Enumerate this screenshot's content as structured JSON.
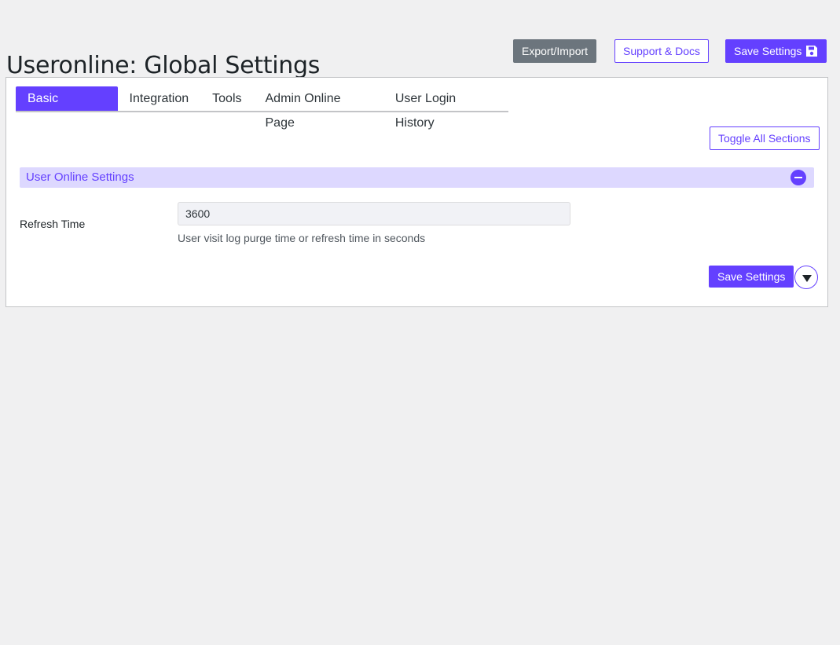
{
  "header": {
    "title": "Useronline: Global Settings",
    "export_import_label": "Export/Import",
    "support_docs_label": "Support & Docs",
    "save_settings_label": "Save Settings",
    "save_icon": "floppy-disk-icon"
  },
  "tabs": [
    {
      "label": "Basic Settings",
      "active": true
    },
    {
      "label": "Integration",
      "active": false
    },
    {
      "label": "Tools",
      "active": false
    },
    {
      "label": "Admin Online Page",
      "active": false
    },
    {
      "label": "User Login History",
      "active": false
    }
  ],
  "toolbar": {
    "toggle_all_label": "Toggle All Sections"
  },
  "section": {
    "title": "User Online Settings",
    "collapse_icon": "minus-circle-icon",
    "fields": [
      {
        "label": "Refresh Time",
        "value": "3600",
        "description": "User visit log purge time or refresh time in seconds"
      }
    ]
  },
  "footer": {
    "save_settings_label": "Save Settings",
    "scroll_icon": "caret-down-icon"
  },
  "colors": {
    "accent": "#6440ff",
    "accent_light": "#ddd8ff",
    "secondary": "#6c757d",
    "background": "#f0f0f1"
  }
}
